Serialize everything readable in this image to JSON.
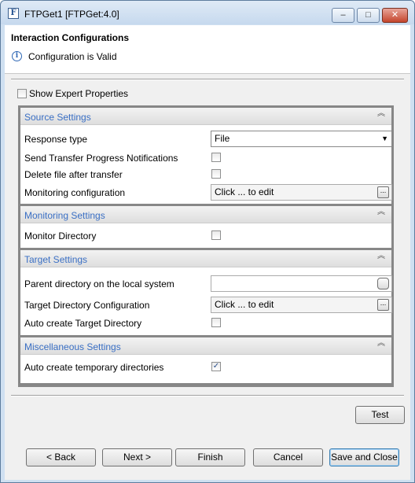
{
  "window": {
    "title": "FTPGet1 [FTPGet:4.0]",
    "app_icon_letter": "F",
    "controls": {
      "minimize": "–",
      "maximize": "□",
      "close": "✕"
    }
  },
  "header": {
    "title": "Interaction Configurations",
    "status": "Configuration is Valid",
    "status_icon": "info-icon"
  },
  "expert": {
    "label": "Show Expert Properties",
    "checked": false
  },
  "sections": {
    "source": {
      "title": "Source Settings",
      "response_type": {
        "label": "Response type",
        "value": "File"
      },
      "send_progress": {
        "label": "Send Transfer Progress Notifications",
        "checked": false
      },
      "delete_after": {
        "label": "Delete file after transfer",
        "checked": false
      },
      "monitoring_config": {
        "label": "Monitoring configuration",
        "value": "Click ... to edit",
        "button": "..."
      }
    },
    "monitoring": {
      "title": "Monitoring Settings",
      "monitor_directory": {
        "label": "Monitor Directory",
        "checked": false
      }
    },
    "target": {
      "title": "Target Settings",
      "parent_dir": {
        "label": "Parent directory on the local system",
        "value": ""
      },
      "target_dir_config": {
        "label": "Target Directory Configuration",
        "value": "Click ... to edit",
        "button": "..."
      },
      "auto_create_target": {
        "label": "Auto create Target Directory",
        "checked": false
      }
    },
    "misc": {
      "title": "Miscellaneous Settings",
      "auto_create_temp": {
        "label": "Auto create temporary directories",
        "checked": true
      }
    }
  },
  "buttons": {
    "test": "Test",
    "back": "< Back",
    "next": "Next >",
    "finish": "Finish",
    "cancel": "Cancel",
    "save_close": "Save and Close"
  },
  "check_glyph": "✓",
  "collapse_glyph": "︽",
  "dropdown_glyph": "▼"
}
